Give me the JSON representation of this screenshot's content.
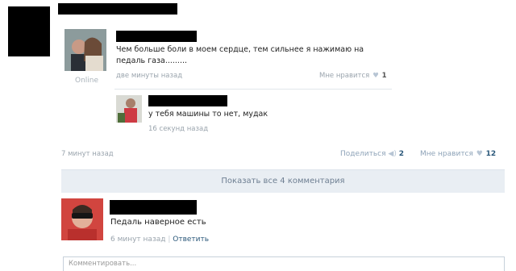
{
  "post": {
    "online_label": "Online",
    "comment_1": {
      "text": "Чем больше боли в моем сердце, тем сильнее я нажимаю на педаль газа.........",
      "time": "две минуты назад",
      "like_label": "Мне нравится",
      "like_count": "1"
    },
    "reply_1": {
      "text": "у тебя машины то нет, мудак",
      "time": "16 секунд назад"
    },
    "footer": {
      "time": "7 минут назад",
      "share_label": "Поделиться",
      "share_count": "2",
      "like_label": "Мне нравится",
      "like_count": "12"
    }
  },
  "comments": {
    "show_all_label": "Показать все 4 комментария",
    "items": [
      {
        "text": "Педаль наверное есть",
        "time": "6 минут назад",
        "reply_label": "Ответить"
      }
    ],
    "input_placeholder": "Комментировать..."
  },
  "colors": {
    "link": "#2b587a",
    "meta": "#9aa4ad",
    "button_bg": "#e9eef3"
  }
}
